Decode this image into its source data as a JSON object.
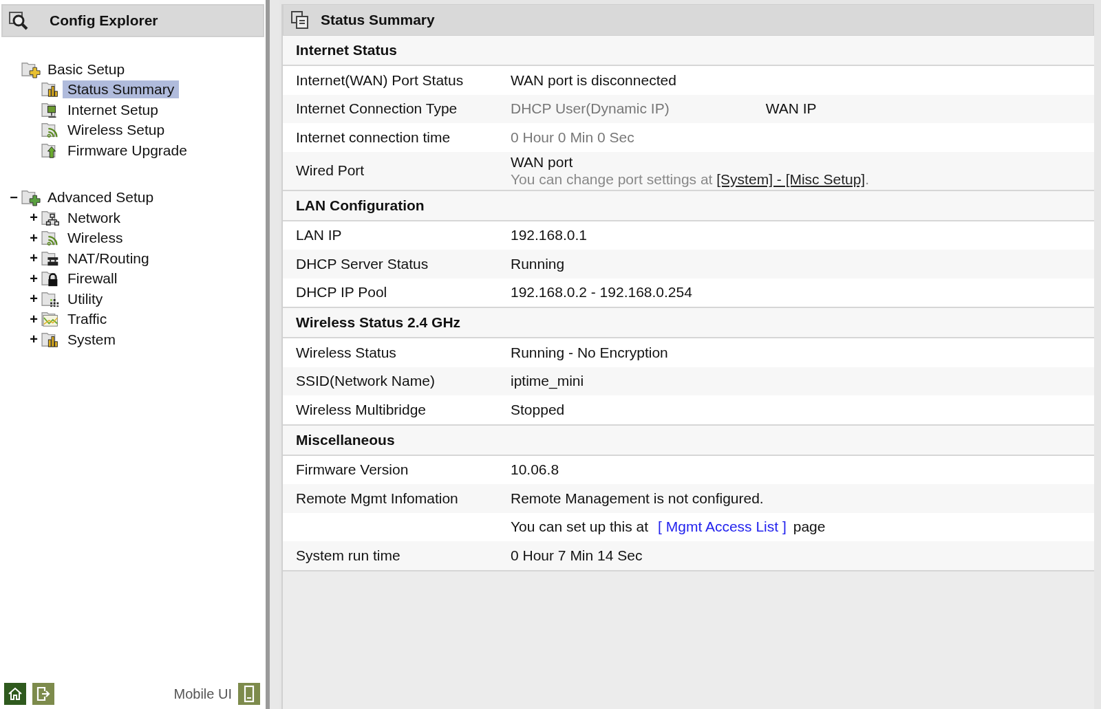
{
  "sidebar": {
    "title": "Config Explorer",
    "groups": [
      {
        "label": "Basic Setup",
        "kind": "basic",
        "children": [
          {
            "label": "Status Summary",
            "kind": "chart",
            "selected": true
          },
          {
            "label": "Internet Setup",
            "kind": "monitor",
            "selected": false
          },
          {
            "label": "Wireless Setup",
            "kind": "wireless",
            "selected": false
          },
          {
            "label": "Firmware Upgrade",
            "kind": "upgrade",
            "selected": false
          }
        ]
      },
      {
        "label": "Advanced Setup",
        "kind": "advanced",
        "toggle": "−",
        "children": [
          {
            "label": "Network",
            "kind": "network",
            "toggle": "+",
            "selected": false
          },
          {
            "label": "Wireless",
            "kind": "wireless",
            "toggle": "+",
            "selected": false
          },
          {
            "label": "NAT/Routing",
            "kind": "router",
            "toggle": "+",
            "selected": false
          },
          {
            "label": "Firewall",
            "kind": "lock",
            "toggle": "+",
            "selected": false
          },
          {
            "label": "Utility",
            "kind": "dots",
            "toggle": "+",
            "selected": false
          },
          {
            "label": "Traffic",
            "kind": "traffic",
            "toggle": "+",
            "selected": false
          },
          {
            "label": "System",
            "kind": "chart",
            "toggle": "+",
            "selected": false
          }
        ]
      }
    ],
    "footer": {
      "mobile_label": "Mobile UI"
    }
  },
  "main": {
    "title": "Status Summary",
    "sections": [
      {
        "title": "Internet Status",
        "rows": [
          {
            "label": "Internet(WAN) Port Status",
            "value": "WAN port is disconnected",
            "muted": false
          },
          {
            "label": "Internet Connection Type",
            "value": "DHCP User(Dynamic IP)",
            "muted": true,
            "extra": "WAN IP"
          },
          {
            "label": "Internet connection time",
            "value": "0 Hour 0 Min 0 Sec",
            "muted": true
          },
          {
            "label": "Wired Port",
            "value": "WAN port",
            "muted": false,
            "note": {
              "text": "You can change port settings at",
              "link": {
                "text": "[System] - [Misc Setup]",
                "kind": "underline"
              },
              "after": "."
            }
          }
        ]
      },
      {
        "title": "LAN Configuration",
        "rows": [
          {
            "label": "LAN IP",
            "value": "192.168.0.1",
            "muted": false
          },
          {
            "label": "DHCP Server Status",
            "value": "Running",
            "muted": false
          },
          {
            "label": "DHCP IP Pool",
            "value": "192.168.0.2 -  192.168.0.254",
            "muted": false
          }
        ]
      },
      {
        "title": "Wireless Status 2.4 GHz",
        "rows": [
          {
            "label": "Wireless Status",
            "value": "Running - No Encryption",
            "muted": false
          },
          {
            "label": "SSID(Network Name)",
            "value": "iptime_mini",
            "muted": false
          },
          {
            "label": "Wireless Multibridge",
            "value": "Stopped",
            "muted": false
          }
        ]
      },
      {
        "title": "Miscellaneous",
        "rows": [
          {
            "label": "Firmware Version",
            "value": "10.06.8",
            "muted": false
          },
          {
            "label": "Remote Mgmt Infomation",
            "value": "Remote Management is not configured.",
            "muted": false
          },
          {
            "value": "You can set up this at",
            "muted": false,
            "link": {
              "text": "[ Mgmt Access List ]",
              "kind": "blue"
            },
            "after": "page"
          },
          {
            "label": "System run time",
            "value": "0 Hour 7 Min 14 Sec",
            "muted": false
          }
        ]
      }
    ]
  }
}
